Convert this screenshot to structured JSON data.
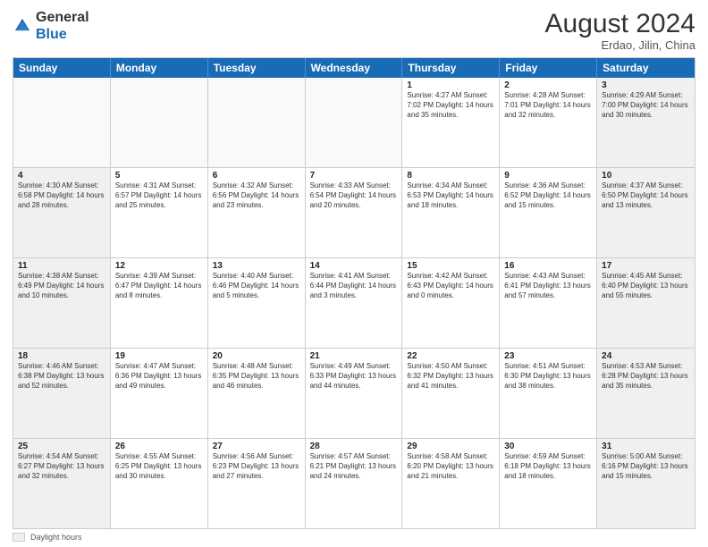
{
  "logo": {
    "general": "General",
    "blue": "Blue"
  },
  "title": {
    "month_year": "August 2024",
    "location": "Erdao, Jilin, China"
  },
  "calendar": {
    "days_of_week": [
      "Sunday",
      "Monday",
      "Tuesday",
      "Wednesday",
      "Thursday",
      "Friday",
      "Saturday"
    ],
    "weeks": [
      [
        {
          "day": "",
          "content": "",
          "empty": true
        },
        {
          "day": "",
          "content": "",
          "empty": true
        },
        {
          "day": "",
          "content": "",
          "empty": true
        },
        {
          "day": "",
          "content": "",
          "empty": true
        },
        {
          "day": "1",
          "content": "Sunrise: 4:27 AM\nSunset: 7:02 PM\nDaylight: 14 hours and 35 minutes.",
          "empty": false
        },
        {
          "day": "2",
          "content": "Sunrise: 4:28 AM\nSunset: 7:01 PM\nDaylight: 14 hours and 32 minutes.",
          "empty": false
        },
        {
          "day": "3",
          "content": "Sunrise: 4:29 AM\nSunset: 7:00 PM\nDaylight: 14 hours and 30 minutes.",
          "empty": false
        }
      ],
      [
        {
          "day": "4",
          "content": "Sunrise: 4:30 AM\nSunset: 6:58 PM\nDaylight: 14 hours and 28 minutes.",
          "empty": false
        },
        {
          "day": "5",
          "content": "Sunrise: 4:31 AM\nSunset: 6:57 PM\nDaylight: 14 hours and 25 minutes.",
          "empty": false
        },
        {
          "day": "6",
          "content": "Sunrise: 4:32 AM\nSunset: 6:56 PM\nDaylight: 14 hours and 23 minutes.",
          "empty": false
        },
        {
          "day": "7",
          "content": "Sunrise: 4:33 AM\nSunset: 6:54 PM\nDaylight: 14 hours and 20 minutes.",
          "empty": false
        },
        {
          "day": "8",
          "content": "Sunrise: 4:34 AM\nSunset: 6:53 PM\nDaylight: 14 hours and 18 minutes.",
          "empty": false
        },
        {
          "day": "9",
          "content": "Sunrise: 4:36 AM\nSunset: 6:52 PM\nDaylight: 14 hours and 15 minutes.",
          "empty": false
        },
        {
          "day": "10",
          "content": "Sunrise: 4:37 AM\nSunset: 6:50 PM\nDaylight: 14 hours and 13 minutes.",
          "empty": false
        }
      ],
      [
        {
          "day": "11",
          "content": "Sunrise: 4:38 AM\nSunset: 6:49 PM\nDaylight: 14 hours and 10 minutes.",
          "empty": false
        },
        {
          "day": "12",
          "content": "Sunrise: 4:39 AM\nSunset: 6:47 PM\nDaylight: 14 hours and 8 minutes.",
          "empty": false
        },
        {
          "day": "13",
          "content": "Sunrise: 4:40 AM\nSunset: 6:46 PM\nDaylight: 14 hours and 5 minutes.",
          "empty": false
        },
        {
          "day": "14",
          "content": "Sunrise: 4:41 AM\nSunset: 6:44 PM\nDaylight: 14 hours and 3 minutes.",
          "empty": false
        },
        {
          "day": "15",
          "content": "Sunrise: 4:42 AM\nSunset: 6:43 PM\nDaylight: 14 hours and 0 minutes.",
          "empty": false
        },
        {
          "day": "16",
          "content": "Sunrise: 4:43 AM\nSunset: 6:41 PM\nDaylight: 13 hours and 57 minutes.",
          "empty": false
        },
        {
          "day": "17",
          "content": "Sunrise: 4:45 AM\nSunset: 6:40 PM\nDaylight: 13 hours and 55 minutes.",
          "empty": false
        }
      ],
      [
        {
          "day": "18",
          "content": "Sunrise: 4:46 AM\nSunset: 6:38 PM\nDaylight: 13 hours and 52 minutes.",
          "empty": false
        },
        {
          "day": "19",
          "content": "Sunrise: 4:47 AM\nSunset: 6:36 PM\nDaylight: 13 hours and 49 minutes.",
          "empty": false
        },
        {
          "day": "20",
          "content": "Sunrise: 4:48 AM\nSunset: 6:35 PM\nDaylight: 13 hours and 46 minutes.",
          "empty": false
        },
        {
          "day": "21",
          "content": "Sunrise: 4:49 AM\nSunset: 6:33 PM\nDaylight: 13 hours and 44 minutes.",
          "empty": false
        },
        {
          "day": "22",
          "content": "Sunrise: 4:50 AM\nSunset: 6:32 PM\nDaylight: 13 hours and 41 minutes.",
          "empty": false
        },
        {
          "day": "23",
          "content": "Sunrise: 4:51 AM\nSunset: 6:30 PM\nDaylight: 13 hours and 38 minutes.",
          "empty": false
        },
        {
          "day": "24",
          "content": "Sunrise: 4:53 AM\nSunset: 6:28 PM\nDaylight: 13 hours and 35 minutes.",
          "empty": false
        }
      ],
      [
        {
          "day": "25",
          "content": "Sunrise: 4:54 AM\nSunset: 6:27 PM\nDaylight: 13 hours and 32 minutes.",
          "empty": false
        },
        {
          "day": "26",
          "content": "Sunrise: 4:55 AM\nSunset: 6:25 PM\nDaylight: 13 hours and 30 minutes.",
          "empty": false
        },
        {
          "day": "27",
          "content": "Sunrise: 4:56 AM\nSunset: 6:23 PM\nDaylight: 13 hours and 27 minutes.",
          "empty": false
        },
        {
          "day": "28",
          "content": "Sunrise: 4:57 AM\nSunset: 6:21 PM\nDaylight: 13 hours and 24 minutes.",
          "empty": false
        },
        {
          "day": "29",
          "content": "Sunrise: 4:58 AM\nSunset: 6:20 PM\nDaylight: 13 hours and 21 minutes.",
          "empty": false
        },
        {
          "day": "30",
          "content": "Sunrise: 4:59 AM\nSunset: 6:18 PM\nDaylight: 13 hours and 18 minutes.",
          "empty": false
        },
        {
          "day": "31",
          "content": "Sunrise: 5:00 AM\nSunset: 6:16 PM\nDaylight: 13 hours and 15 minutes.",
          "empty": false
        }
      ]
    ]
  },
  "footer": {
    "legend_label": "Daylight hours"
  }
}
